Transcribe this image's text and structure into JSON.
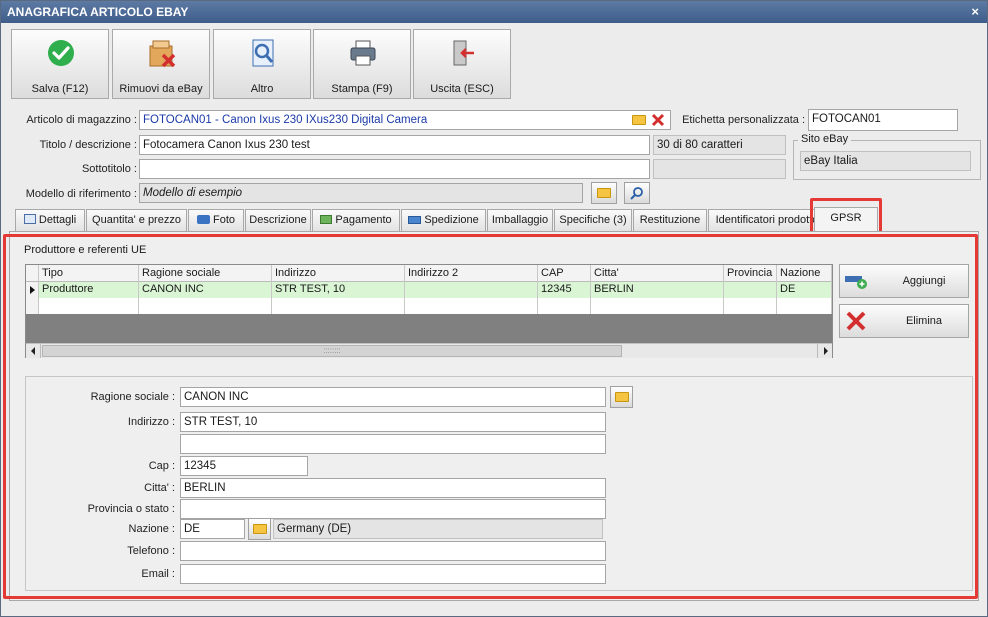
{
  "window": {
    "title": "ANAGRAFICA ARTICOLO EBAY",
    "close_glyph": "×"
  },
  "toolbar": [
    {
      "label": "Salva (F12)",
      "icon": "check-circle-icon"
    },
    {
      "label": "Rimuovi da eBay",
      "icon": "box-remove-icon"
    },
    {
      "label": "Altro",
      "icon": "magnifier-doc-icon"
    },
    {
      "label": "Stampa (F9)",
      "icon": "printer-icon"
    },
    {
      "label": "Uscita (ESC)",
      "icon": "exit-door-icon"
    }
  ],
  "header": {
    "articolo_label": "Articolo di magazzino :",
    "articolo_value": "FOTOCAN01 - Canon Ixus 230 IXus230 Digital Camera",
    "etichetta_label": "Etichetta personalizzata :",
    "etichetta_value": "FOTOCAN01",
    "titolo_label": "Titolo / descrizione :",
    "titolo_value": "Fotocamera Canon Ixus 230 test",
    "titolo_counter": "30 di 80 caratteri",
    "sottotitolo_label": "Sottotitolo :",
    "sottotitolo_value": "",
    "modello_label": "Modello di riferimento :",
    "modello_value": "Modello di esempio",
    "sito_title": "Sito eBay",
    "sito_value": "eBay Italia"
  },
  "tabs": [
    {
      "label": "Dettagli"
    },
    {
      "label": "Quantita' e prezzo"
    },
    {
      "label": "Foto"
    },
    {
      "label": "Descrizione"
    },
    {
      "label": "Pagamento"
    },
    {
      "label": "Spedizione"
    },
    {
      "label": "Imballaggio"
    },
    {
      "label": "Specifiche (3)"
    },
    {
      "label": "Restituzione"
    },
    {
      "label": "Identificatori prodotto"
    },
    {
      "label": "GPSR"
    }
  ],
  "gpsr": {
    "section_title": "Produttore e referenti UE",
    "columns": [
      "Tipo",
      "Ragione sociale",
      "Indirizzo",
      "Indirizzo 2",
      "CAP",
      "Citta'",
      "Provincia",
      "Nazione"
    ],
    "rows": [
      [
        "Produttore",
        "CANON INC",
        "STR TEST, 10",
        "",
        "12345",
        "BERLIN",
        "",
        "DE"
      ]
    ],
    "add_button": "Aggiungi",
    "delete_button": "Elimina",
    "scroll_grip": "::::::::",
    "form": {
      "ragione_label": "Ragione sociale :",
      "ragione_value": "CANON INC",
      "indirizzo_label": "Indirizzo :",
      "indirizzo_value": "STR TEST, 10",
      "indirizzo2_value": "",
      "cap_label": "Cap :",
      "cap_value": "12345",
      "citta_label": "Citta' :",
      "citta_value": "BERLIN",
      "provincia_label": "Provincia o stato :",
      "provincia_value": "",
      "nazione_label": "Nazione :",
      "nazione_code": "DE",
      "nazione_name": "Germany (DE)",
      "telefono_label": "Telefono :",
      "telefono_value": "",
      "email_label": "Email :",
      "email_value": ""
    }
  },
  "colors": {
    "accent_red": "#e53935",
    "row_highlight": "#d9f5d4",
    "title_bar": "#3e5d8a"
  }
}
